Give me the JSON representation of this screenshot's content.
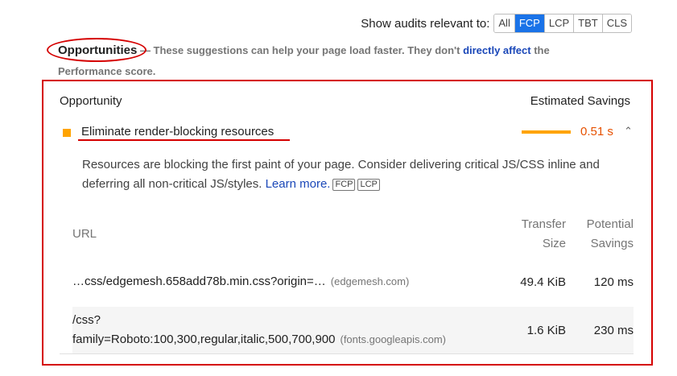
{
  "filters": {
    "label": "Show audits relevant to:",
    "buttons": [
      {
        "label": "All",
        "active": false
      },
      {
        "label": "FCP",
        "active": true
      },
      {
        "label": "LCP",
        "active": false
      },
      {
        "label": "TBT",
        "active": false
      },
      {
        "label": "CLS",
        "active": false
      }
    ]
  },
  "opportunities": {
    "title": "Opportunities",
    "desc_before": " — These suggestions can help your page load faster. They don't ",
    "link": "directly affect",
    "desc_after": " the Performance score."
  },
  "panel": {
    "col_opportunity": "Opportunity",
    "col_savings": "Estimated Savings",
    "audit": {
      "title": "Eliminate render-blocking resources",
      "savings": "0.51 s",
      "description": "Resources are blocking the first paint of your page. Consider delivering critical JS/CSS inline and deferring all non-critical JS/styles. ",
      "learn_more": "Learn more.",
      "badges": [
        "FCP",
        "LCP"
      ],
      "table": {
        "headers": {
          "url": "URL",
          "size": "Transfer Size",
          "savings": "Potential Savings"
        },
        "rows": [
          {
            "url": "…css/edgemesh.658add78b.min.css?origin=…",
            "host": "(edgemesh.com)",
            "size": "49.4 KiB",
            "savings": "120 ms"
          },
          {
            "url_line1": "/css?",
            "url_line2": "family=Roboto:100,300,regular,italic,500,700,900",
            "host": "(fonts.googleapis.com)",
            "size": "1.6 KiB",
            "savings": "230 ms"
          }
        ]
      }
    }
  },
  "colors": {
    "accent": "#1a73e8",
    "annotation": "#d50000",
    "average": "#ffa400",
    "savings_text": "#e65100"
  }
}
